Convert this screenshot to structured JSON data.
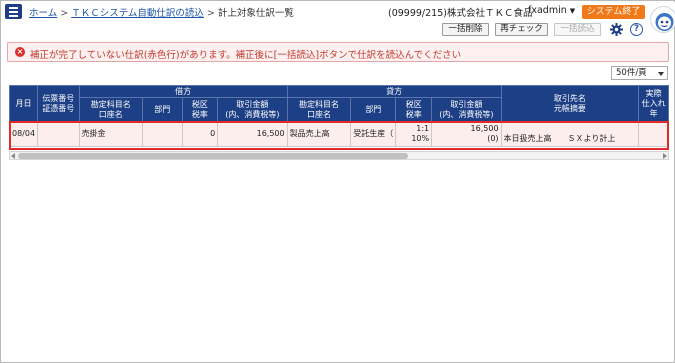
{
  "header": {
    "breadcrumb": [
      {
        "label": "ホーム"
      },
      {
        "label": "ＴＫＣシステム自動仕訳の読込"
      },
      {
        "label": "計上対象仕訳一覧"
      }
    ],
    "separator": ">",
    "company": "(09999/215)株式会社ＴＫＣ食品",
    "user": "fxadmin",
    "system_end": "システム終了"
  },
  "toolbar": {
    "bulk_delete": "一括削除",
    "recheck": "再チェック",
    "bulk_read": "一括読込"
  },
  "message": {
    "text": "補正が完了していない仕訳(赤色行)があります。補正後に[一括読込]ボタンで仕訳を読込んでください"
  },
  "pagination": {
    "per_page": "50件/頁"
  },
  "table": {
    "header_group": {
      "debit": "借方",
      "credit": "貸方"
    },
    "columns": {
      "date": "月日",
      "voucher": [
        "伝票番号",
        "証憑番号"
      ],
      "debit_account": [
        "勘定科目名",
        "口座名"
      ],
      "debit_dept": "部門",
      "debit_tax": [
        "税区",
        "税率"
      ],
      "debit_amount": [
        "取引金額",
        "(内、消費税等)"
      ],
      "credit_account": [
        "勘定科目名",
        "口座名"
      ],
      "credit_dept": "部門",
      "credit_tax": [
        "税区",
        "税率"
      ],
      "credit_amount": [
        "取引金額",
        "(内、消費税等)"
      ],
      "partner": [
        "取引先名",
        "元帳摘要"
      ],
      "actual": [
        "実際",
        "仕入れ年"
      ]
    },
    "rows": [
      {
        "date": "08/04",
        "voucher": "",
        "debit_account": "売掛金",
        "debit_dept": "",
        "debit_tax": "0",
        "debit_amount": "16,500",
        "credit_account": "製品売上高",
        "credit_dept": "受託生産（",
        "credit_tax_1": "1:1",
        "credit_tax_2": "10%",
        "credit_amount_1": "16,500",
        "credit_amount_2": "(0)",
        "partner": "本日扱売上高　　ＳＸより計上"
      }
    ]
  },
  "colors": {
    "header_bg": "#1d3f85",
    "error_row": "#fdeeee",
    "highlight": "#e22a2a",
    "system_end": "#f07a1a",
    "link": "#1d56a6"
  }
}
